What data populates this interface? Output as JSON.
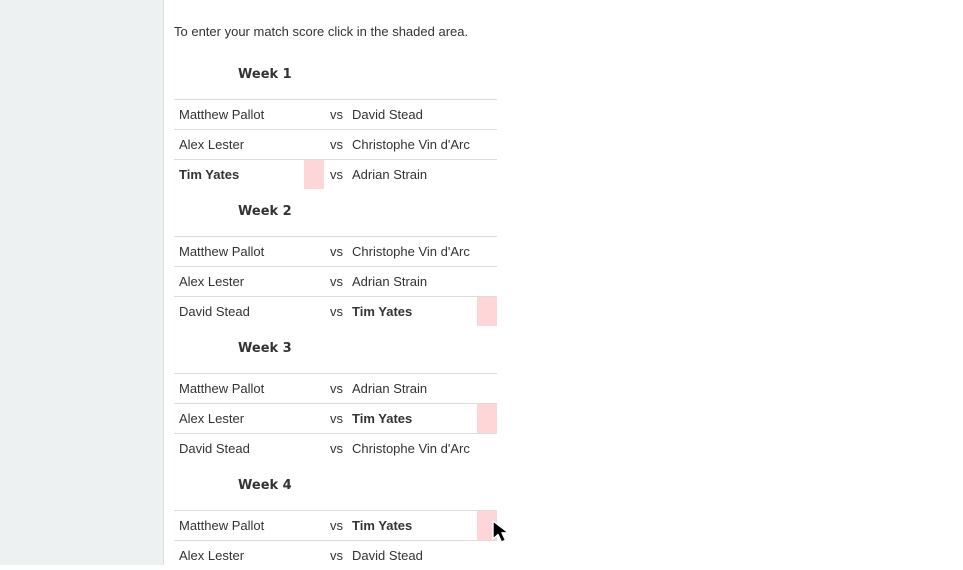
{
  "instructions": "To enter your match score click in the shaded area.",
  "weeks": [
    {
      "title": "Week 1",
      "matches": [
        {
          "player1": "Matthew Pallot",
          "vs": "vs",
          "player2": "David Stead"
        },
        {
          "player1": "Alex Lester",
          "vs": "vs",
          "player2": "Christophe Vin d'Arc"
        },
        {
          "player1": "Tim Yates",
          "vs": "vs",
          "player2": "Adrian Strain"
        }
      ]
    },
    {
      "title": "Week 2",
      "matches": [
        {
          "player1": "Matthew Pallot",
          "vs": "vs",
          "player2": "Christophe Vin d'Arc"
        },
        {
          "player1": "Alex Lester",
          "vs": "vs",
          "player2": "Adrian Strain"
        },
        {
          "player1": "David Stead",
          "vs": "vs",
          "player2": "Tim Yates"
        }
      ]
    },
    {
      "title": "Week 3",
      "matches": [
        {
          "player1": "Matthew Pallot",
          "vs": "vs",
          "player2": "Adrian Strain"
        },
        {
          "player1": "Alex Lester",
          "vs": "vs",
          "player2": "Tim Yates"
        },
        {
          "player1": "David Stead",
          "vs": "vs",
          "player2": "Christophe Vin d'Arc"
        }
      ]
    },
    {
      "title": "Week 4",
      "matches": [
        {
          "player1": "Matthew Pallot",
          "vs": "vs",
          "player2": "Tim Yates"
        },
        {
          "player1": "Alex Lester",
          "vs": "vs",
          "player2": "David Stead"
        }
      ]
    }
  ],
  "colors": {
    "score_area": "#ffd6d8",
    "sidebar": "#edf1f2",
    "row_border": "#dcdcdc"
  },
  "icons": {
    "cursor": "mouse-pointer-icon"
  }
}
